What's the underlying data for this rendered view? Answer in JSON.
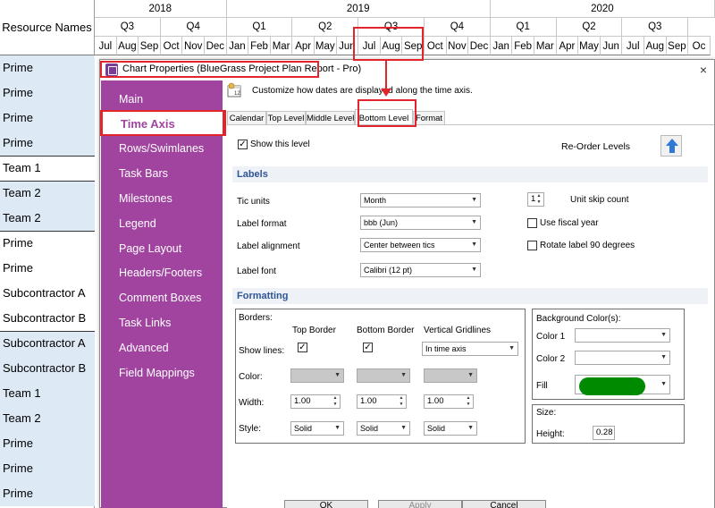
{
  "timeline": {
    "resource_header": "Resource Names",
    "years": [
      {
        "label": "2018",
        "span": 6
      },
      {
        "label": "2019",
        "span": 12
      },
      {
        "label": "2020",
        "span": 12
      }
    ],
    "quarters": [
      "Q3",
      "Q4",
      "Q1",
      "Q2",
      "Q3",
      "Q4",
      "Q1",
      "Q2",
      "Q3"
    ],
    "months": [
      "Jul",
      "Aug",
      "Sep",
      "Oct",
      "Nov",
      "Dec",
      "Jan",
      "Feb",
      "Mar",
      "Apr",
      "May",
      "Jun",
      "Jul",
      "Aug",
      "Sep",
      "Oct",
      "Nov",
      "Dec",
      "Jan",
      "Feb",
      "Mar",
      "Apr",
      "May",
      "Jun",
      "Jul",
      "Aug",
      "Sep",
      "Oc"
    ]
  },
  "resources": [
    "Prime",
    "Prime",
    "Prime",
    "Prime",
    "Team 1",
    "Team 2",
    "Team 2",
    "Prime",
    "Prime",
    "Subcontractor A",
    "Subcontractor B",
    "Subcontractor A",
    "Subcontractor B",
    "Team 1",
    "Team 2",
    "Prime",
    "Prime",
    "Prime"
  ],
  "dialog": {
    "title": "Chart Properties (BlueGrass Project Plan Report - Pro)",
    "close": "×",
    "description": "Customize how dates are displayed along the time axis.",
    "sidebar": [
      "Main",
      "Time Axis",
      "Rows/Swimlanes",
      "Task Bars",
      "Milestones",
      "Legend",
      "Page Layout",
      "Headers/Footers",
      "Comment Boxes",
      "Task Links",
      "Advanced",
      "Field Mappings"
    ],
    "tabs": [
      "Calendar",
      "Top Level",
      "Middle Level",
      "Bottom Level",
      "Format"
    ],
    "show_level": {
      "label": "Show this level",
      "checked": true
    },
    "reorder_label": "Re-Order Levels",
    "labels_section": {
      "heading": "Labels",
      "tic_units": {
        "label": "Tic units",
        "value": "Month"
      },
      "label_format": {
        "label": "Label format",
        "value": "bbb (Jun)"
      },
      "label_alignment": {
        "label": "Label alignment",
        "value": "Center between tics"
      },
      "label_font": {
        "label": "Label font",
        "value": "Calibri (12 pt)"
      },
      "unit_skip": {
        "value": "1",
        "label": "Unit skip count"
      },
      "fiscal_year": {
        "label": "Use fiscal year",
        "checked": false
      },
      "rotate": {
        "label": "Rotate label 90 degrees",
        "checked": false
      }
    },
    "formatting_section": {
      "heading": "Formatting",
      "borders_label": "Borders:",
      "top_border": "Top Border",
      "bottom_border": "Bottom Border",
      "vertical_gridlines": "Vertical Gridlines",
      "show_lines": "Show lines:",
      "gridlines_value": "In time axis",
      "color": "Color:",
      "width": "Width:",
      "style": "Style:",
      "width_values": [
        "1.00",
        "1.00",
        "1.00"
      ],
      "style_values": [
        "Solid",
        "Solid",
        "Solid"
      ],
      "background_label": "Background Color(s):",
      "color1": "Color 1",
      "color2": "Color 2",
      "fill": "Fill",
      "fill_color": "#008a00",
      "size_label": "Size:",
      "height_label": "Height:",
      "height_value": "0.28"
    },
    "buttons": [
      "OK",
      "Apply",
      "Cancel"
    ]
  },
  "colors": {
    "sidebar_bg": "#a044a0",
    "annotation_red": "#e2252b",
    "resource_blue_band": "#ddeaf6",
    "section_heading": "#2f5597"
  }
}
